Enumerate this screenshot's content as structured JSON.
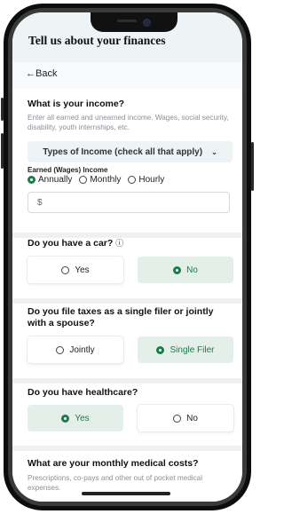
{
  "header": {
    "title": "Tell us about your finances",
    "back_label": "←Back"
  },
  "income": {
    "question": "What is your income?",
    "hint": "Enter all earned and unearned income. Wages, social security, disability, youth internships, etc.",
    "types_label": "Types of Income (check all that apply)",
    "earned_label": "Earned (Wages) Income",
    "frequency_options": [
      "Annually",
      "Monthly",
      "Hourly"
    ],
    "frequency_selected": "Annually",
    "amount_placeholder": "$"
  },
  "car": {
    "question": "Do you have a car?",
    "options": [
      "Yes",
      "No"
    ],
    "selected": "No"
  },
  "taxes": {
    "question": "Do you file taxes as a single filer or jointly with a spouse?",
    "options": [
      "Jointly",
      "Single Filer"
    ],
    "selected": "Single Filer"
  },
  "healthcare": {
    "question": "Do you have healthcare?",
    "options": [
      "Yes",
      "No"
    ],
    "selected": "Yes"
  },
  "medical": {
    "question": "What are your monthly medical costs?",
    "hint": "Prescriptions, co-pays and other out of pocket medical expenses."
  },
  "colors": {
    "accent": "#1d7a4a",
    "selected_bg": "#e4efea",
    "background": "#f7fafb"
  }
}
